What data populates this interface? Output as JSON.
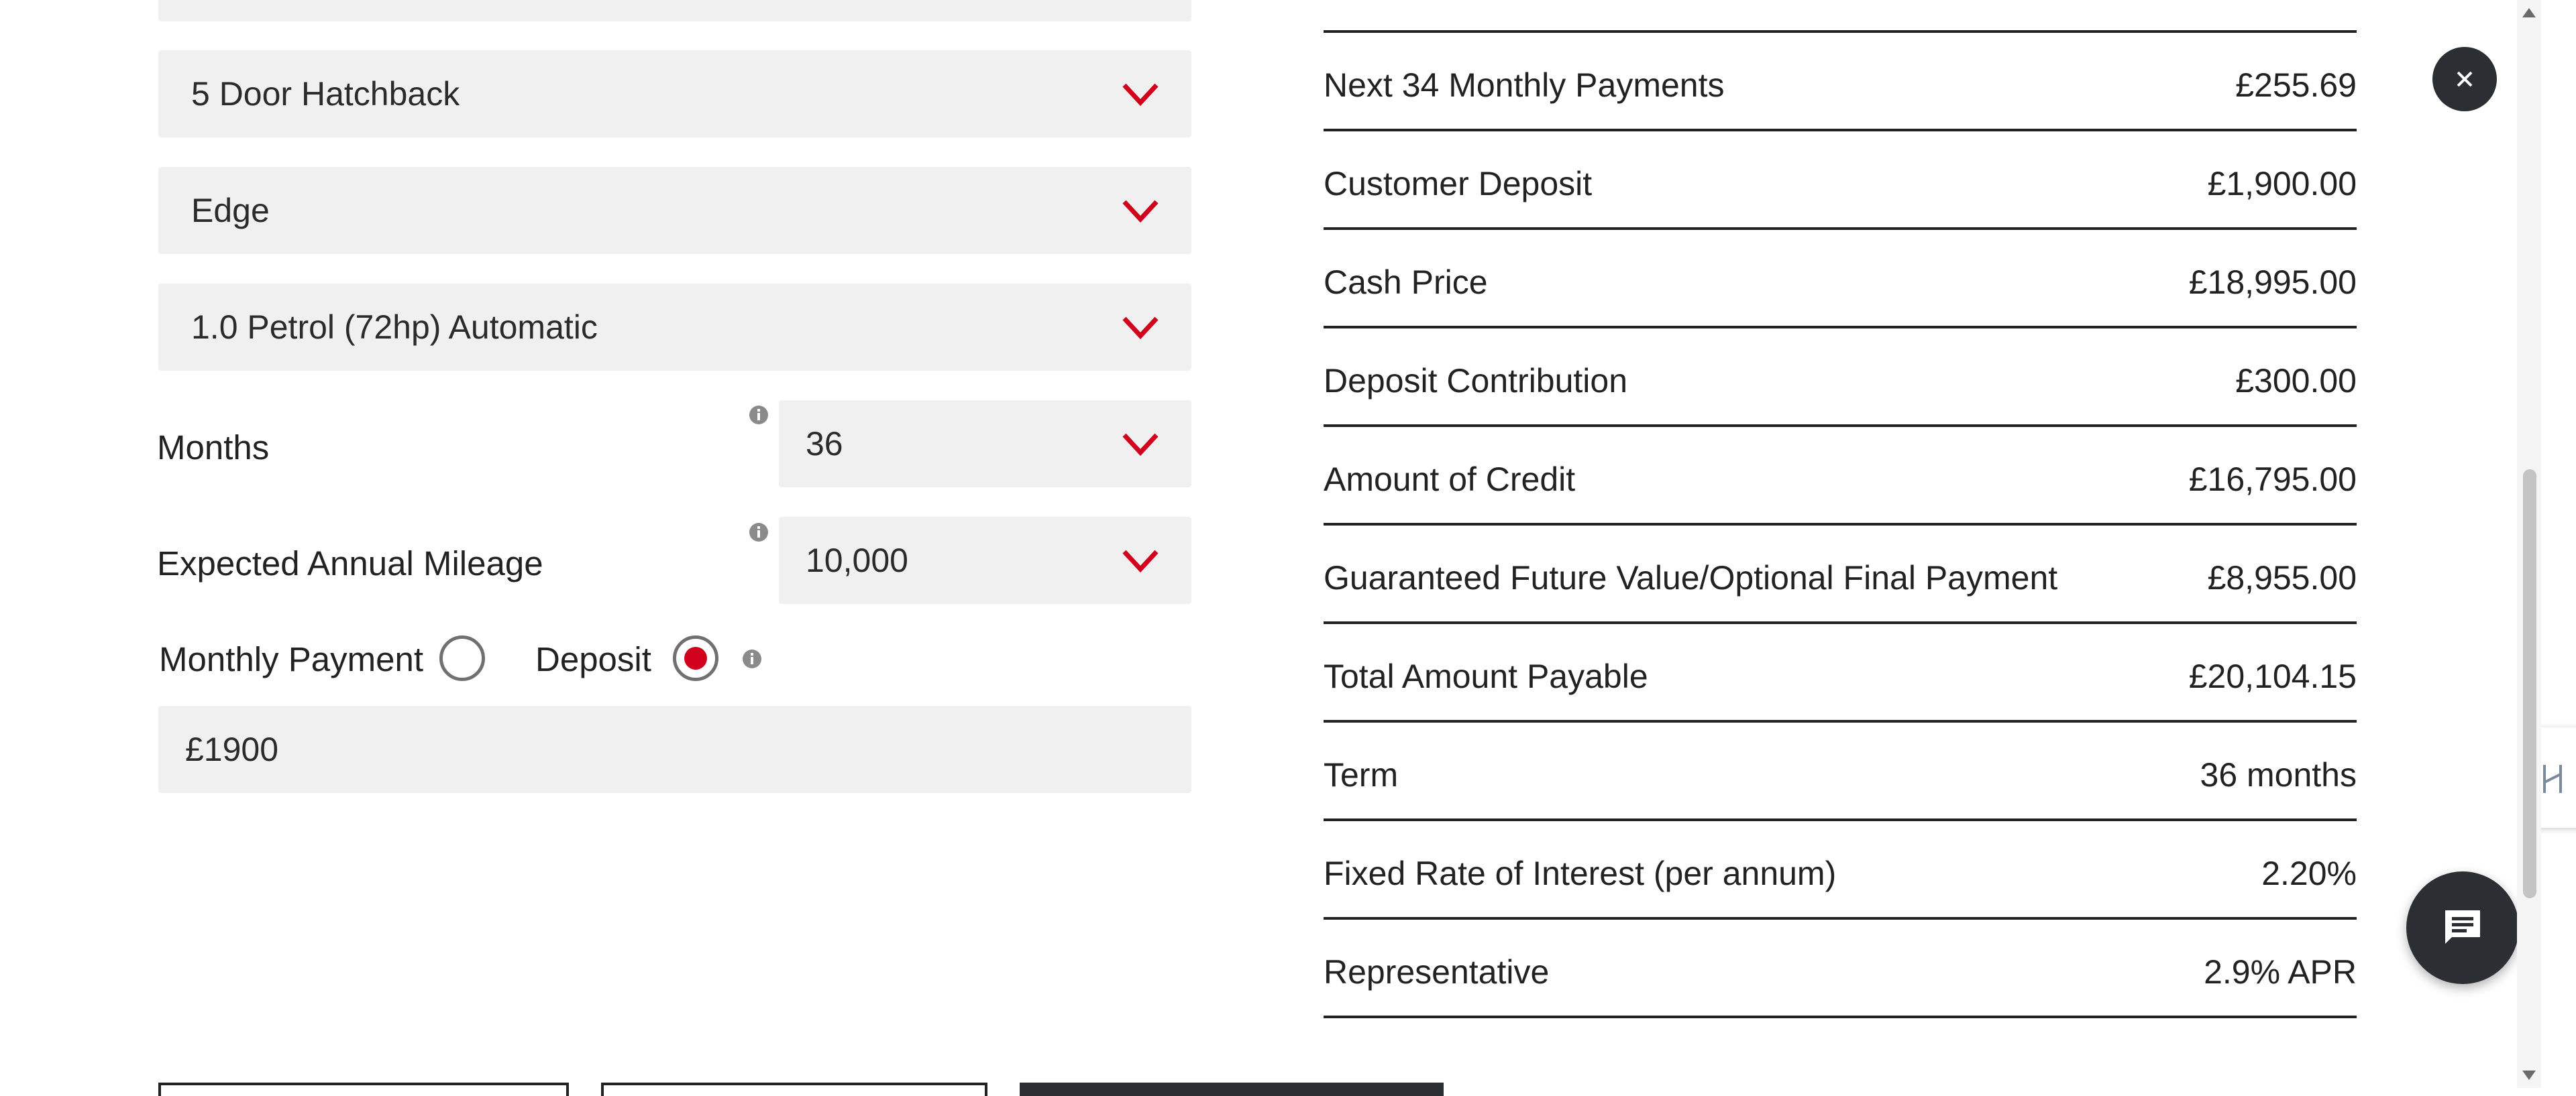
{
  "form": {
    "body_style": "5 Door Hatchback",
    "trim": "Edge",
    "engine": "1.0 Petrol (72hp) Automatic",
    "months_label": "Months",
    "months_value": "36",
    "mileage_label": "Expected Annual Mileage",
    "mileage_value": "10,000",
    "radio_monthly_label": "Monthly Payment",
    "radio_deposit_label": "Deposit",
    "selected_mode": "Deposit",
    "deposit_input_value": "£1900"
  },
  "summary": {
    "rows": [
      {
        "label": "Next 34 Monthly Payments",
        "value": "£255.69"
      },
      {
        "label": "Customer Deposit",
        "value": "£1,900.00"
      },
      {
        "label": "Cash Price",
        "value": "£18,995.00"
      },
      {
        "label": "Deposit Contribution",
        "value": "£300.00"
      },
      {
        "label": "Amount of Credit",
        "value": "£16,795.00"
      },
      {
        "label": "Guaranteed Future Value/Optional Final Payment",
        "value": "£8,955.00"
      },
      {
        "label": "Total Amount Payable",
        "value": "£20,104.15"
      },
      {
        "label": "Term",
        "value": "36 months"
      },
      {
        "label": "Fixed Rate of Interest (per annum)",
        "value": "2.20%"
      },
      {
        "label": "Representative",
        "value": "2.9% APR"
      }
    ]
  },
  "icons": {
    "close": "close-icon",
    "chat": "chat-icon",
    "info": "info-icon",
    "chevron": "chevron-down-icon"
  },
  "colors": {
    "accent_red": "#d1001c",
    "field_bg": "#f0f0f0",
    "dark_button": "#2b2f33"
  }
}
